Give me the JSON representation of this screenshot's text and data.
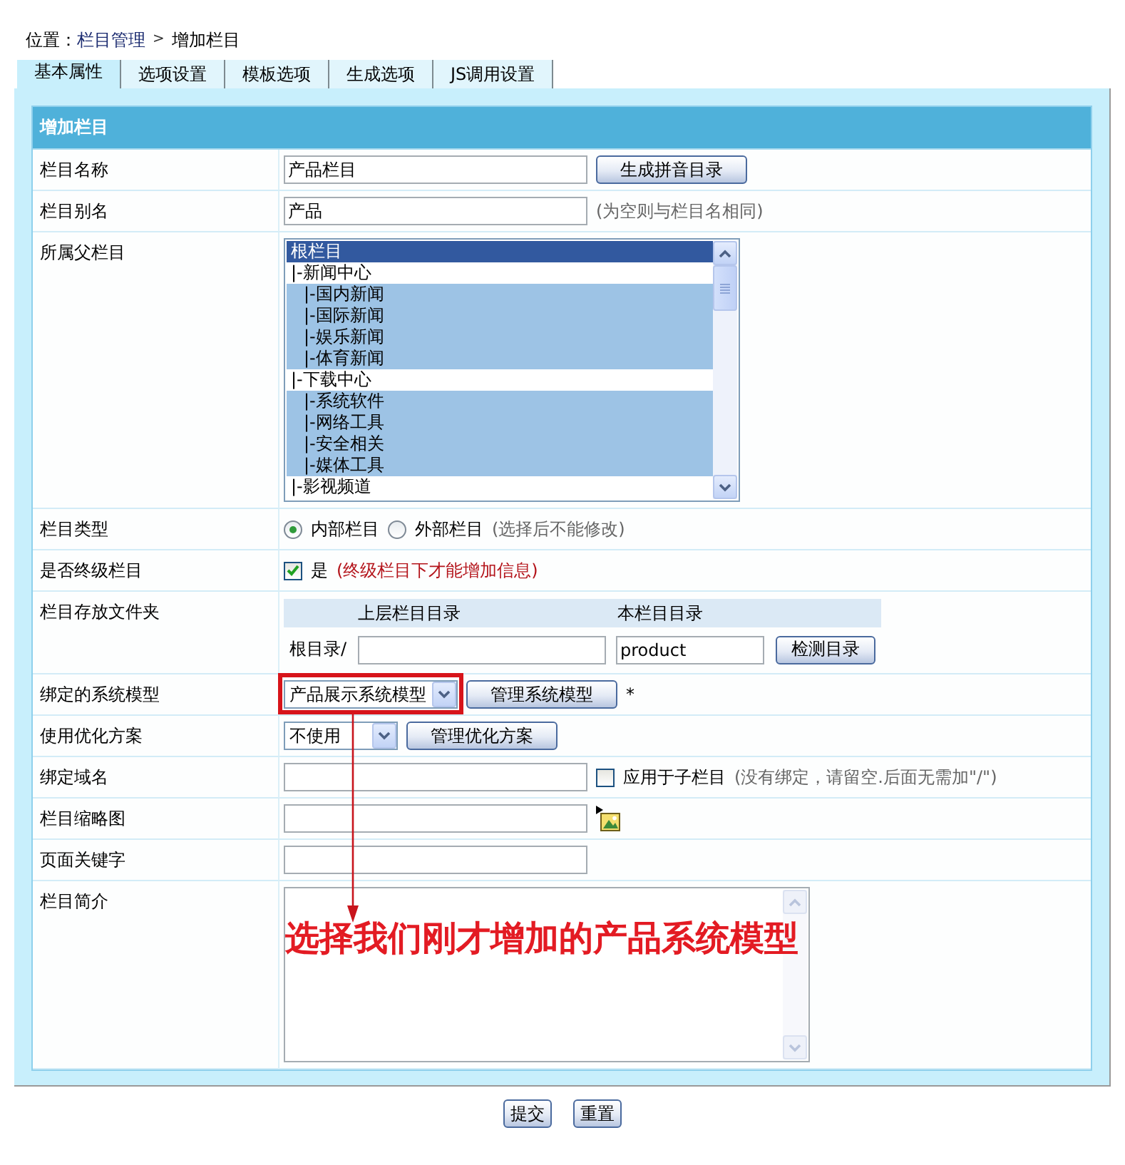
{
  "breadcrumb": {
    "label": "位置：",
    "separator": ">",
    "items": [
      {
        "kind": "link",
        "text": "栏目管理"
      },
      {
        "kind": "current",
        "text": "增加栏目"
      }
    ]
  },
  "tabs": [
    {
      "label": "基本属性",
      "selected": true
    },
    {
      "label": "选项设置",
      "selected": false
    },
    {
      "label": "模板选项",
      "selected": false
    },
    {
      "label": "生成选项",
      "selected": false
    },
    {
      "label": "JS调用设置",
      "selected": false
    }
  ],
  "form": {
    "title": "增加栏目",
    "rows": [
      {
        "label": "栏目名称",
        "controls": [
          {
            "kind": "input",
            "value": "产品栏目"
          },
          {
            "kind": "button",
            "label": "生成拼音目录"
          }
        ]
      },
      {
        "label": "栏目别名",
        "controls": [
          {
            "kind": "input",
            "value": "产品"
          },
          {
            "kind": "note",
            "text": "(为空则与栏目名相同)"
          }
        ]
      },
      {
        "label": "所属父栏目",
        "controls": [
          {
            "kind": "listbox",
            "options": [
              {
                "label": "根栏目",
                "selected": true
              },
              {
                "label": "|-新闻中心",
                "selected": false,
                "children": [
                  {
                    "label": "|-国内新闻",
                    "selected": false
                  },
                  {
                    "label": "|-国际新闻",
                    "selected": false
                  },
                  {
                    "label": "|-娱乐新闻",
                    "selected": false
                  },
                  {
                    "label": "|-体育新闻",
                    "selected": false
                  }
                ]
              },
              {
                "label": "|-下载中心",
                "selected": false,
                "children": [
                  {
                    "label": "|-系统软件",
                    "selected": false
                  },
                  {
                    "label": "|-网络工具",
                    "selected": false
                  },
                  {
                    "label": "|-安全相关",
                    "selected": false
                  },
                  {
                    "label": "|-媒体工具",
                    "selected": false
                  }
                ]
              },
              {
                "label": "|-影视频道",
                "selected": false
              }
            ]
          }
        ]
      },
      {
        "label": "栏目类型",
        "controls": [
          {
            "kind": "radio",
            "label": "内部栏目",
            "selected": true
          },
          {
            "kind": "radio",
            "label": "外部栏目",
            "selected": false
          },
          {
            "kind": "note",
            "text": "(选择后不能修改)"
          }
        ]
      },
      {
        "label": "是否终级栏目",
        "controls": [
          {
            "kind": "checkbox",
            "label": "是",
            "checked": true
          },
          {
            "kind": "warning",
            "text": "(终级栏目下才能增加信息)"
          }
        ]
      },
      {
        "label": "栏目存放文件夹",
        "controls": [
          {
            "kind": "folder",
            "columns": [
              "上层栏目目录",
              "本栏目目录"
            ],
            "prefix": "根目录/",
            "value": "product",
            "button": "检测目录"
          }
        ]
      },
      {
        "label": "绑定的系统模型",
        "controls": [
          {
            "kind": "select",
            "value": "产品展示系统模型",
            "highlighted": true
          },
          {
            "kind": "button",
            "label": "管理系统模型"
          },
          {
            "kind": "required",
            "text": "*"
          }
        ]
      },
      {
        "label": "使用优化方案",
        "controls": [
          {
            "kind": "select",
            "value": "不使用",
            "highlighted": false
          },
          {
            "kind": "button",
            "label": "管理优化方案"
          }
        ]
      },
      {
        "label": "绑定域名",
        "controls": [
          {
            "kind": "input"
          },
          {
            "kind": "checkbox",
            "label": "应用于子栏目",
            "checked": false
          },
          {
            "kind": "note",
            "text": "(没有绑定，请留空.后面无需加\"/\")"
          }
        ]
      },
      {
        "label": "栏目缩略图",
        "controls": [
          {
            "kind": "input"
          },
          {
            "kind": "image_picker"
          }
        ]
      },
      {
        "label": "页面关键字",
        "controls": [
          {
            "kind": "input"
          }
        ]
      },
      {
        "label": "栏目简介",
        "controls": [
          {
            "kind": "textarea"
          }
        ]
      }
    ]
  },
  "annotation": {
    "text": "选择我们刚才增加的产品系统模型"
  },
  "actions": [
    {
      "label": "提交"
    },
    {
      "label": "重置"
    }
  ]
}
